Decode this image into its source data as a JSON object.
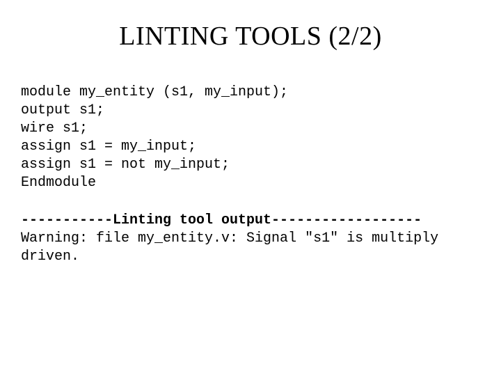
{
  "title": "LINTING TOOLS (2/2)",
  "code": {
    "l1": "module my_entity (s1, my_input);",
    "l2": "output s1;",
    "l3": "wire s1;",
    "l4": "assign s1 = my_input;",
    "l5": "assign s1 = not my_input;",
    "l6": "Endmodule"
  },
  "output": {
    "header": "-----------Linting tool output------------------",
    "warning": "Warning: file my_entity.v: Signal \"s1\" is multiply driven."
  }
}
